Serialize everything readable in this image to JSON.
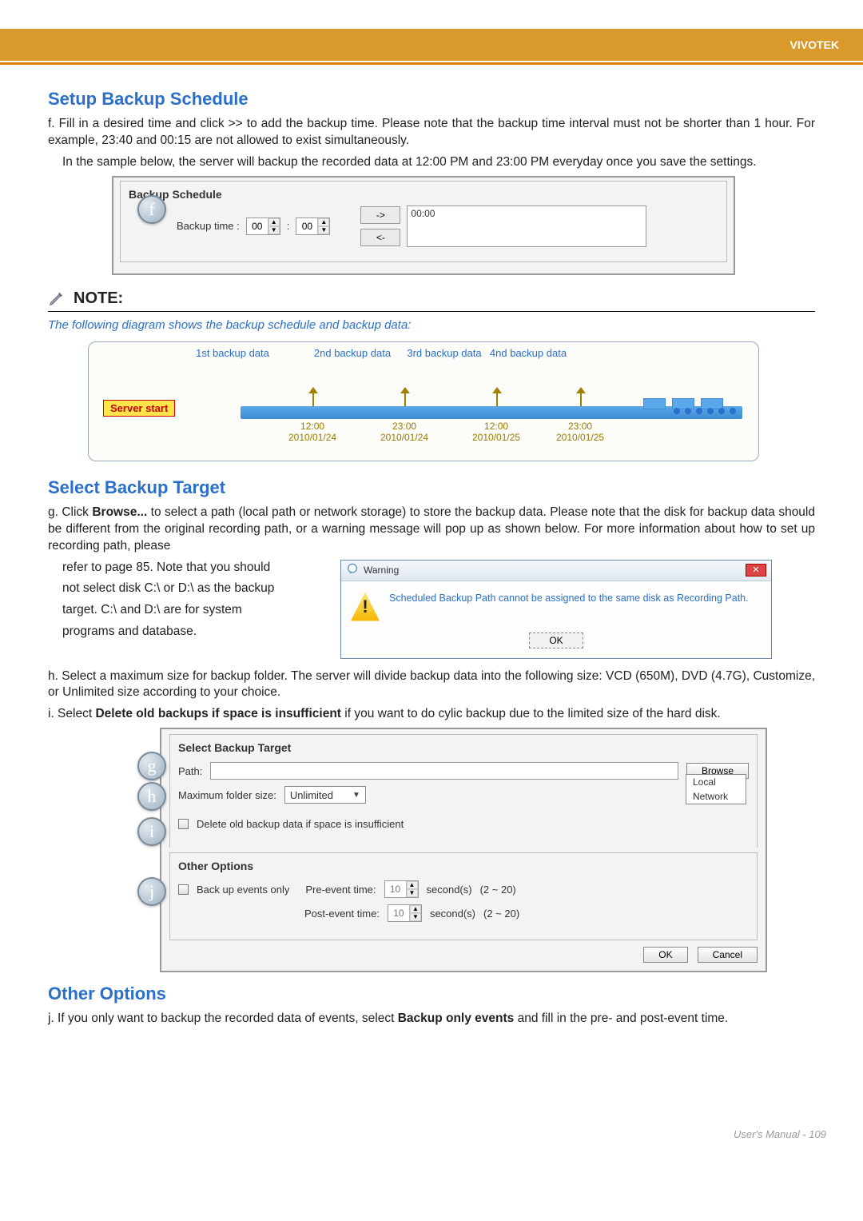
{
  "header": {
    "brand": "VIVOTEK"
  },
  "sections": {
    "setup_title": "Setup Backup Schedule",
    "f_para1": "f. Fill in a desired time and click >> to add the backup time. Please note that the backup time interval must not be shorter than 1 hour. For example, 23:40 and 00:15 are not allowed to exist simultaneously.",
    "f_para2": "In the sample below, the server will backup the recorded data at 12:00 PM and 23:00 PM everyday once you save the settings.",
    "backup_schedule": {
      "group_title": "Backup Schedule",
      "label": "Backup time :",
      "hh": "00",
      "mm": "00",
      "add_btn": "->",
      "remove_btn": "<-",
      "list_item": "00:00",
      "callout": "f"
    },
    "note_label": "NOTE:",
    "note_text": "The following diagram shows the backup schedule and backup data:",
    "diagram": {
      "b1": "1st backup data",
      "b2": "2nd backup data",
      "b3": "3rd backup data",
      "b4": "4nd backup data",
      "server": "Server start",
      "t1": "12:00",
      "d1": "2010/01/24",
      "t2": "23:00",
      "d2": "2010/01/24",
      "t3": "12:00",
      "d3": "2010/01/25",
      "t4": "23:00",
      "d4": "2010/01/25"
    },
    "select_title": "Select Backup Target",
    "g_text": "g. Click Browse... to select a path (local path or network storage) to store the backup data. Please note that the disk for backup data should be different from the original recording path, or a warning message will pop up as shown below. For more information about how to set up recording path, please refer to page 85. Note that you should not select disk C:\\ or D:\\ as the backup target. C:\\ and D:\\ are for system programs and database.",
    "g_text_side1": "refer to page 85. Note that you should",
    "g_text_side2": "not select disk C:\\ or D:\\ as the backup",
    "g_text_side3": "target. C:\\ and D:\\ are for system",
    "g_text_side4": "programs and database.",
    "warning": {
      "title": "Warning",
      "msg": "Scheduled Backup Path cannot be assigned to the same disk as Recording Path.",
      "ok": "OK"
    },
    "h_text": "h. Select a maximum size for backup folder. The server will divide backup data into the following size: VCD (650M), DVD (4.7G), Customize, or Unlimited size according to your choice.",
    "i_text": "i. Select Delete old backups if space is insufficient if you want to do cylic backup due to the limited size of the hard disk.",
    "select_target": {
      "group_title": "Select Backup Target",
      "path_label": "Path:",
      "browse": "Browse",
      "list_local": "Local",
      "list_network": "Network",
      "max_label": "Maximum folder size:",
      "max_value": "Unlimited",
      "delete_label": "Delete old backup data if space is insufficient",
      "other_title": "Other Options",
      "backup_events": "Back up events only",
      "pre_label": "Pre-event time:",
      "post_label": "Post-event time:",
      "pre_val": "10",
      "post_val": "10",
      "seconds": "second(s)",
      "range": "(2 ~ 20)",
      "ok": "OK",
      "cancel": "Cancel",
      "callout_g": "g",
      "callout_h": "h",
      "callout_i": "i",
      "callout_j": "j"
    },
    "other_title": "Other Options",
    "j_text": "j. If you only want to backup the recorded data of events, select Backup only events and fill in the pre- and post-event time."
  },
  "footer": {
    "label": "User's Manual -",
    "page": "109"
  }
}
